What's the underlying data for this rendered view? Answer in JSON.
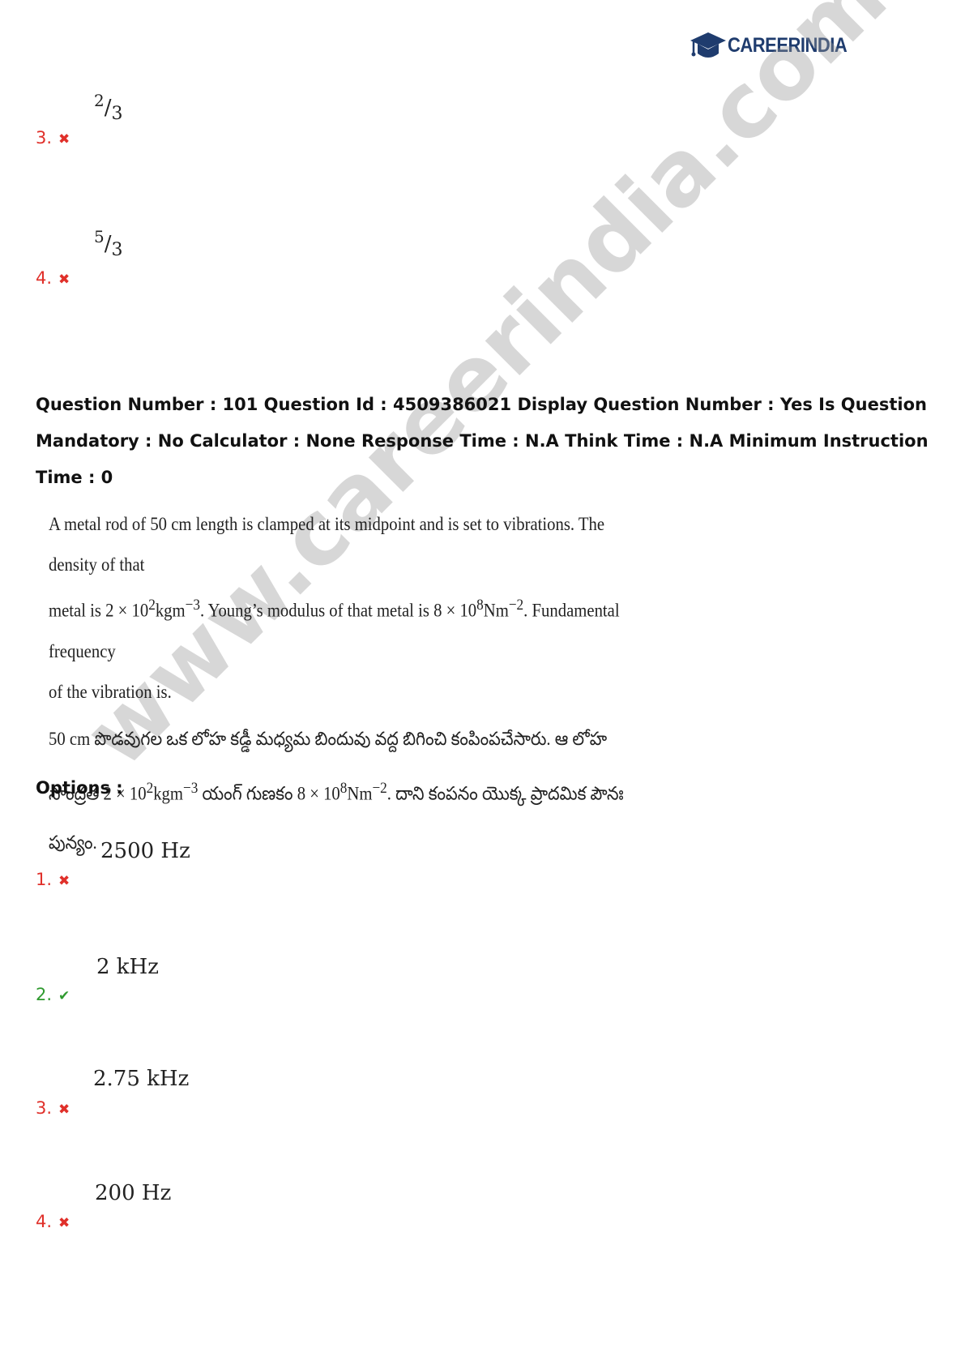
{
  "header": {
    "logo_text_a": "CAREER",
    "logo_text_b": "INDIA"
  },
  "prev_options": [
    {
      "number": "3.",
      "status": "wrong",
      "status_glyph": "✖",
      "numerator": "2",
      "denominator": "3"
    },
    {
      "number": "4.",
      "status": "wrong",
      "status_glyph": "✖",
      "numerator": "5",
      "denominator": "3"
    }
  ],
  "question": {
    "meta": "Question Number : 101 Question Id : 4509386021 Display Question Number : Yes Is Question Mandatory : No Calculator : None Response Time : N.A Think Time : N.A Minimum Instruction Time : 0",
    "en_line1": "A metal rod of 50 cm length is clamped at its midpoint and is set to vibrations. The density of that",
    "en_line2_a": "metal is 2 × 10",
    "en_line2_sup1": "2",
    "en_line2_b": "kgm",
    "en_line2_sup2": "−3",
    "en_line2_c": ". Young’s modulus of that metal is 8 × 10",
    "en_line2_sup3": "8",
    "en_line2_d": "Nm",
    "en_line2_sup4": "−2",
    "en_line2_e": ". Fundamental frequency",
    "en_line3": "of the vibration is.",
    "te_line1": "50 cm పొడవుగల ఒక లోహ కడ్డీ మధ్యమ బిందువు వద్ద  బిగించి కంపింపచేసారు. ఆ లోహ",
    "te_line2_a": "సాంద్రత 2 × 10",
    "te_line2_sup1": "2",
    "te_line2_b": "kgm",
    "te_line2_sup2": "−3",
    "te_line2_c": " యంగ్ గుణకం 8 × 10",
    "te_line2_sup3": "8",
    "te_line2_d": "Nm",
    "te_line2_sup4": "−2",
    "te_line2_e": ". దాని కంపనం యొక్క ప్రాదమిక పౌనః",
    "te_line3": "పున్యం."
  },
  "options_label": "Options :",
  "options": [
    {
      "number": "1.",
      "status": "wrong",
      "status_glyph": "✖",
      "value": "2500 Hz"
    },
    {
      "number": "2.",
      "status": "correct",
      "status_glyph": "✔",
      "value": "2 kHz"
    },
    {
      "number": "3.",
      "status": "wrong",
      "status_glyph": "✖",
      "value": "2.75 kHz"
    },
    {
      "number": "4.",
      "status": "wrong",
      "status_glyph": "✖",
      "value": "200 Hz"
    }
  ],
  "watermark": "www.careerindia.com",
  "colors": {
    "wrong": "#e0302a",
    "correct": "#2f9a2f",
    "logo": "#1f3c6e"
  }
}
